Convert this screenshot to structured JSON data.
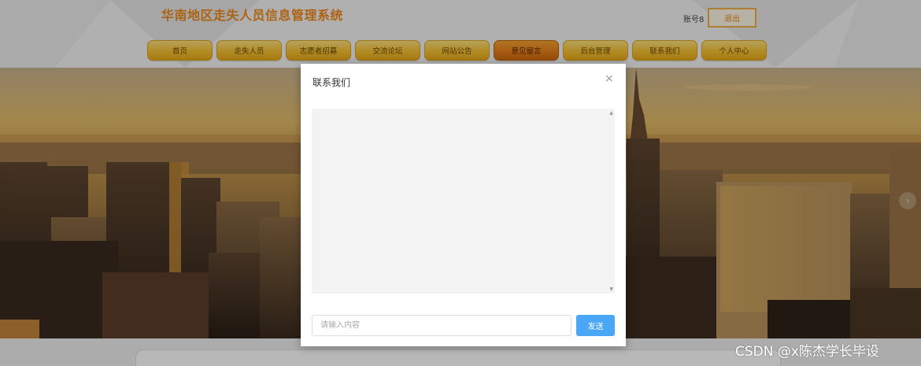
{
  "header": {
    "site_title": "华南地区走失人员信息管理系统",
    "account_label": "账号8",
    "logout_label": "退出"
  },
  "nav": {
    "items": [
      {
        "label": "首页"
      },
      {
        "label": "走失人员"
      },
      {
        "label": "志愿者招募"
      },
      {
        "label": "交流论坛"
      },
      {
        "label": "网站公告"
      },
      {
        "label": "意见留言",
        "active": true
      },
      {
        "label": "后台管理"
      },
      {
        "label": "联系我们"
      },
      {
        "label": "个人中心"
      }
    ]
  },
  "banner": {
    "next_arrow_icon": "chevron-right-icon"
  },
  "modal": {
    "title": "联系我们",
    "close_icon": "close-icon",
    "input_placeholder": "请输入内容",
    "input_value": "",
    "send_label": "发送"
  },
  "watermark": "CSDN @x陈杰学长毕设",
  "colors": {
    "title_orange": "#f08a1c",
    "nav_gold": "#f6c232",
    "nav_active": "#e7801a",
    "send_blue": "#4aa6f7"
  }
}
